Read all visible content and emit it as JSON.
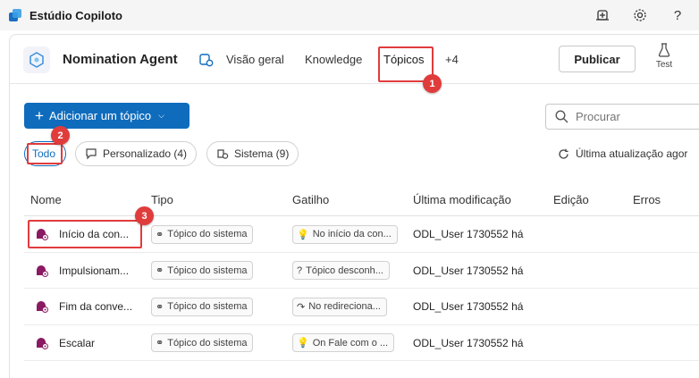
{
  "app": {
    "title": "Estúdio Copiloto"
  },
  "topbar_icons": [
    "diagnostics-icon",
    "gear-icon",
    "help-icon"
  ],
  "agent": {
    "name": "Nomination Agent"
  },
  "nav": {
    "items": [
      "Visão geral",
      "Knowledge",
      "Tópicos",
      "+4"
    ],
    "active": "Tópicos"
  },
  "actions": {
    "publish": "Publicar",
    "test": "Test"
  },
  "toolbar": {
    "add_label": "Adicionar um tópico",
    "search_placeholder": "Procurar"
  },
  "filters": {
    "all": "Todo",
    "custom": "Personalizado (4)",
    "system": "Sistema (9)"
  },
  "updated_text": "Última atualização agor",
  "table": {
    "headers": [
      "Nome",
      "Tipo",
      "Gatilho",
      "Última modificação",
      "Edição",
      "Erros"
    ],
    "rows": [
      {
        "name": "Início da con...",
        "type": "Tópico do sistema",
        "trigger": "No início da con...",
        "trigger_icon": "lightbulb",
        "modified": "ODL_User 1730552  há"
      },
      {
        "name": "Impulsionam...",
        "type": "Tópico do sistema",
        "trigger": "Tópico desconh...",
        "trigger_icon": "question",
        "modified": "ODL_User 1730552  há"
      },
      {
        "name": "Fim da conve...",
        "type": "Tópico do sistema",
        "trigger": "No redireciona...",
        "trigger_icon": "redirect",
        "modified": "ODL_User 1730552  há"
      },
      {
        "name": "Escalar",
        "type": "Tópico do sistema",
        "trigger": "On Fale com o ...",
        "trigger_icon": "lightbulb",
        "modified": "ODL_User 1730552  há"
      }
    ]
  },
  "callouts": [
    "1",
    "2",
    "3"
  ],
  "colors": {
    "accent": "#0f6cbd",
    "callout": "#e03c3c",
    "topic_icon": "#8a1a62"
  }
}
